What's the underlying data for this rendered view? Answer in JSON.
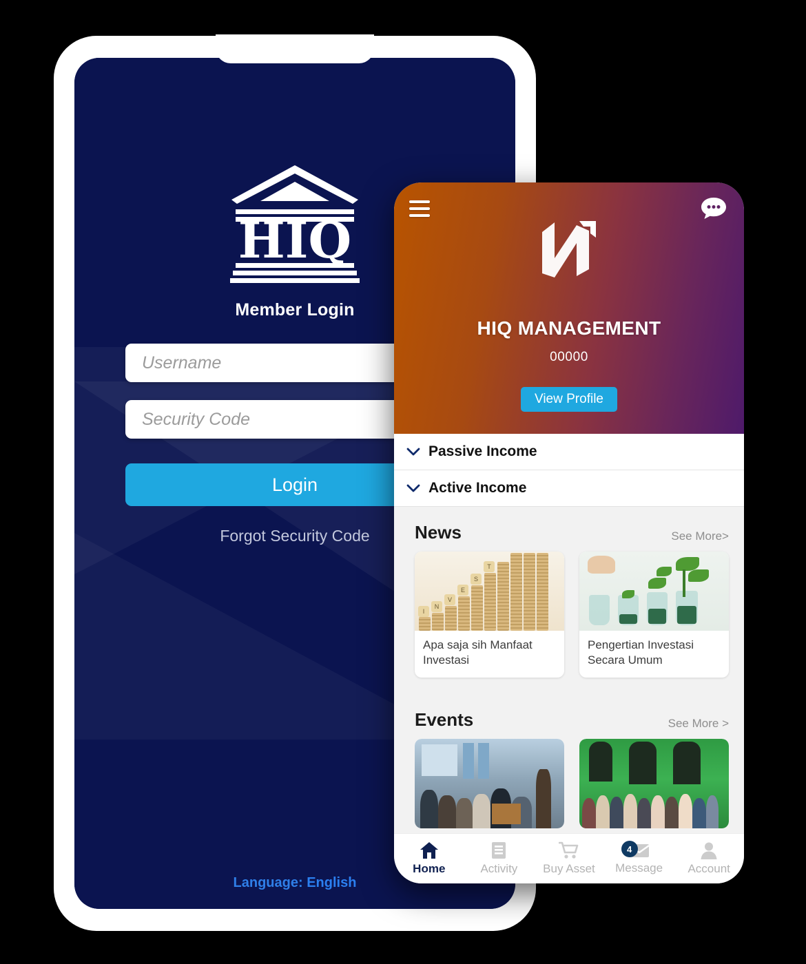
{
  "login_phone": {
    "logo_text": "HIQ",
    "title": "Member Login",
    "username_placeholder": "Username",
    "security_placeholder": "Security Code",
    "login_button": "Login",
    "forgot_link": "Forgot Security Code",
    "language_label": "Language:",
    "language_value": "English",
    "bg_color": "#0b1450",
    "accent_color": "#1FA8E0"
  },
  "app_phone": {
    "header": {
      "menu_icon": "hamburger-icon",
      "chat_icon": "chat-bubble-icon",
      "logo_icon": "n-arrow-logo",
      "brand": "HIQ MANAGEMENT",
      "member_id": "00000",
      "view_profile": "View Profile",
      "gradient_from": "#b85400",
      "gradient_to": "#4e1a6a"
    },
    "accordions": [
      {
        "label": "Passive Income",
        "icon": "chevron-down-icon"
      },
      {
        "label": "Active Income",
        "icon": "chevron-down-icon"
      }
    ],
    "news": {
      "title": "News",
      "see_more": "See More>",
      "items": [
        {
          "caption": "Apa saja sih Manfaat Investasi",
          "image": "coin-stacks-invest-photo"
        },
        {
          "caption": "Pengertian Investasi Secara Umum",
          "image": "hand-coin-jars-plants-photo"
        }
      ]
    },
    "events": {
      "title": "Events",
      "see_more": "See More >",
      "items": [
        {
          "image": "seminar-room-audience-photo"
        },
        {
          "image": "group-photo-green-building"
        }
      ]
    },
    "nav": [
      {
        "label": "Home",
        "icon": "home-icon",
        "active": true,
        "badge": ""
      },
      {
        "label": "Activity",
        "icon": "list-icon",
        "active": false,
        "badge": ""
      },
      {
        "label": "Buy Asset",
        "icon": "cart-icon",
        "active": false,
        "badge": ""
      },
      {
        "label": "Message",
        "icon": "envelope-icon",
        "active": false,
        "badge": "4"
      },
      {
        "label": "Account",
        "icon": "person-icon",
        "active": false,
        "badge": ""
      }
    ]
  }
}
